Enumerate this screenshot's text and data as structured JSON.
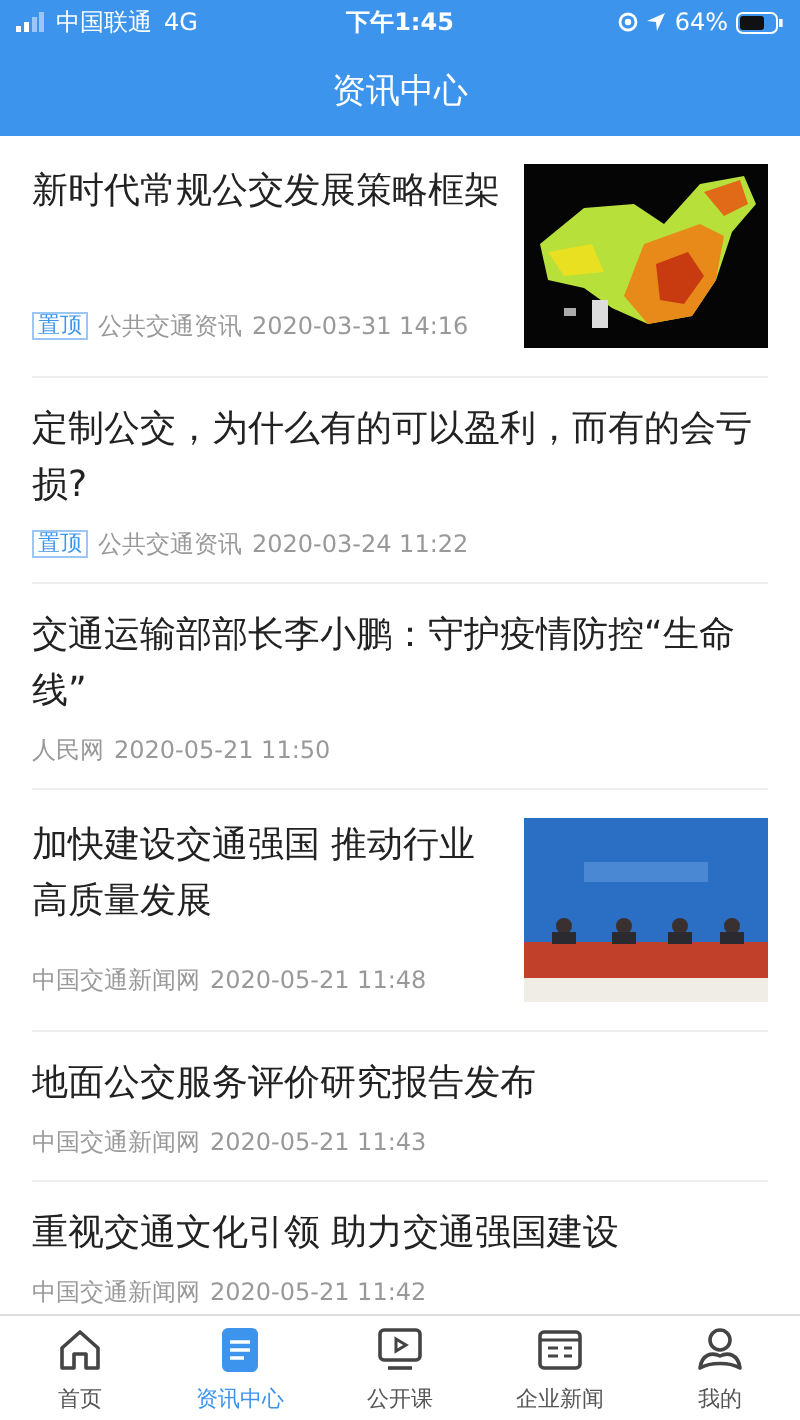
{
  "status_bar": {
    "carrier": "中国联通",
    "network": "4G",
    "time": "下午1:45",
    "battery": "64%"
  },
  "header": {
    "title": "资讯中心"
  },
  "articles": [
    {
      "title": "新时代常规公交发展策略框架",
      "pinned": true,
      "pin_label": "置顶",
      "source": "公共交通资讯",
      "date": "2020-03-31 14:16"
    },
    {
      "title": "定制公交，为什么有的可以盈利，而有的会亏损?",
      "pinned": true,
      "pin_label": "置顶",
      "source": "公共交通资讯",
      "date": "2020-03-24 11:22"
    },
    {
      "title": "交通运输部部长李小鹏：守护疫情防控“生命线”",
      "pinned": false,
      "source": "人民网",
      "date": "2020-05-21 11:50"
    },
    {
      "title": "加快建设交通强国 推动行业高质量发展",
      "pinned": false,
      "source": "中国交通新闻网",
      "date": "2020-05-21 11:48"
    },
    {
      "title": "地面公交服务评价研究报告发布",
      "pinned": false,
      "source": "中国交通新闻网",
      "date": "2020-05-21 11:43"
    },
    {
      "title": "重视交通文化引领 助力交通强国建设",
      "pinned": false,
      "source": "中国交通新闻网",
      "date": "2020-05-21 11:42"
    }
  ],
  "tab_bar": [
    {
      "label": "首页",
      "selected": false
    },
    {
      "label": "资讯中心",
      "selected": true
    },
    {
      "label": "公开课",
      "selected": false
    },
    {
      "label": "企业新闻",
      "selected": false
    },
    {
      "label": "我的",
      "selected": false
    }
  ]
}
